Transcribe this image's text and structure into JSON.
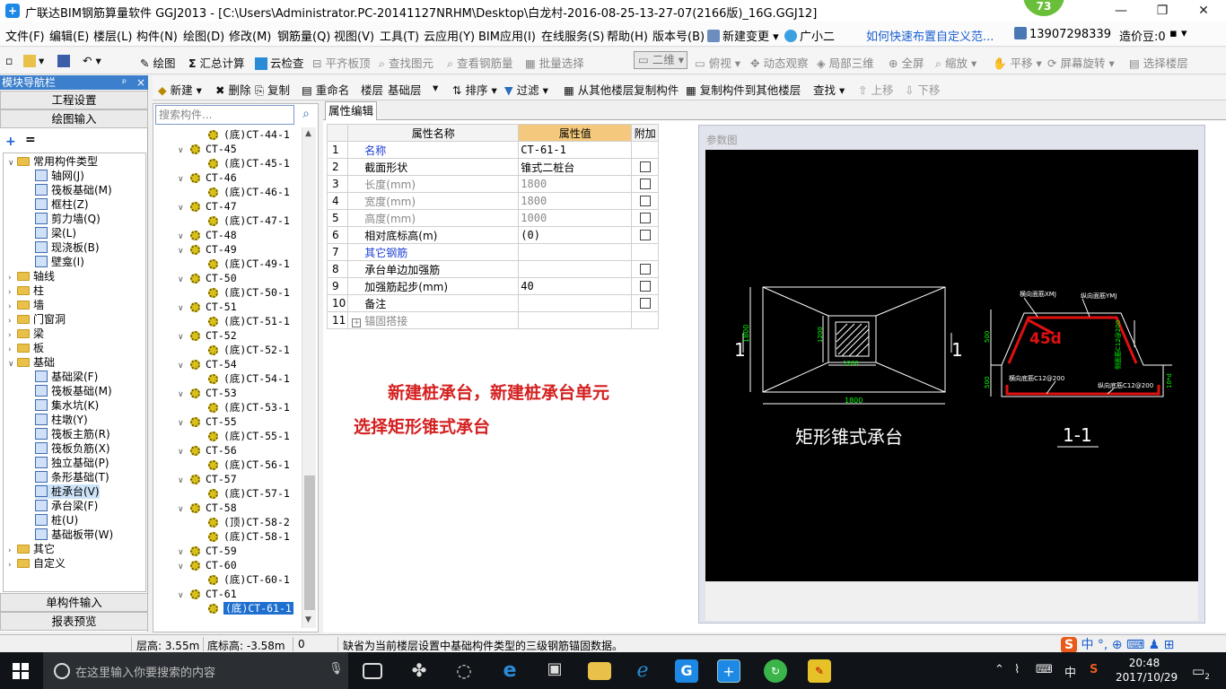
{
  "titlebar": {
    "title": "广联达BIM钢筋算量软件 GGJ2013 - [C:\\Users\\Administrator.PC-20141127NRHM\\Desktop\\白龙村-2016-08-25-13-27-07(2166版)_16G.GGJ12]",
    "badge": "73",
    "min": "—",
    "max": "❐",
    "close": "✕"
  },
  "menubar": {
    "items": [
      "文件(F)",
      "编辑(E)",
      "楼层(L)",
      "构件(N)",
      "绘图(D)",
      "修改(M)",
      "钢筋量(Q)",
      "视图(V)",
      "工具(T)",
      "云应用(Y)",
      "BIM应用(I)",
      "在线服务(S)",
      "帮助(H)",
      "版本号(B)"
    ],
    "new_change": "新建变更",
    "assistant": "广小二",
    "help_link": "如何快速布置自定义范...",
    "phone": "13907298339",
    "price_beans": "造价豆:0"
  },
  "toolbar1": {
    "draw": "绘图",
    "sum": "汇总计算",
    "cloud_check": "云检查",
    "flush_top": "平齐板顶",
    "find_element": "查找图元",
    "view_rebar": "查看钢筋量",
    "batch_select": "批量选择",
    "view_mode": "二维",
    "top_view": "俯视",
    "dynamic": "动态观察",
    "local_3d": "局部三维",
    "fullscreen": "全屏",
    "zoom": "缩放",
    "pan": "平移",
    "rotate": "屏幕旋转",
    "select_floor": "选择楼层"
  },
  "leftnav": {
    "header": "模块导航栏",
    "pin": "ᵖ",
    "close": "×",
    "project_settings": "工程设置",
    "drawing_input": "绘图输入",
    "single_input": "单构件输入",
    "report_preview": "报表预览",
    "tree": [
      {
        "label": "常用构件类型",
        "level": 0,
        "toggle": "∨",
        "kind": "folder"
      },
      {
        "label": "轴网(J)",
        "level": 1,
        "kind": "item"
      },
      {
        "label": "筏板基础(M)",
        "level": 1,
        "kind": "item"
      },
      {
        "label": "框柱(Z)",
        "level": 1,
        "kind": "item"
      },
      {
        "label": "剪力墙(Q)",
        "level": 1,
        "kind": "item"
      },
      {
        "label": "梁(L)",
        "level": 1,
        "kind": "item"
      },
      {
        "label": "现浇板(B)",
        "level": 1,
        "kind": "item"
      },
      {
        "label": "壁龛(I)",
        "level": 1,
        "kind": "item"
      },
      {
        "label": "轴线",
        "level": 0,
        "toggle": "›",
        "kind": "folder"
      },
      {
        "label": "柱",
        "level": 0,
        "toggle": "›",
        "kind": "folder"
      },
      {
        "label": "墙",
        "level": 0,
        "toggle": "›",
        "kind": "folder"
      },
      {
        "label": "门窗洞",
        "level": 0,
        "toggle": "›",
        "kind": "folder"
      },
      {
        "label": "梁",
        "level": 0,
        "toggle": "›",
        "kind": "folder"
      },
      {
        "label": "板",
        "level": 0,
        "toggle": "›",
        "kind": "folder"
      },
      {
        "label": "基础",
        "level": 0,
        "toggle": "∨",
        "kind": "folder"
      },
      {
        "label": "基础梁(F)",
        "level": 1,
        "kind": "item"
      },
      {
        "label": "筏板基础(M)",
        "level": 1,
        "kind": "item"
      },
      {
        "label": "集水坑(K)",
        "level": 1,
        "kind": "item"
      },
      {
        "label": "柱墩(Y)",
        "level": 1,
        "kind": "item"
      },
      {
        "label": "筏板主筋(R)",
        "level": 1,
        "kind": "item"
      },
      {
        "label": "筏板负筋(X)",
        "level": 1,
        "kind": "item"
      },
      {
        "label": "独立基础(P)",
        "level": 1,
        "kind": "item"
      },
      {
        "label": "条形基础(T)",
        "level": 1,
        "kind": "item"
      },
      {
        "label": "桩承台(V)",
        "level": 1,
        "kind": "item",
        "selected": true
      },
      {
        "label": "承台梁(F)",
        "level": 1,
        "kind": "item"
      },
      {
        "label": "桩(U)",
        "level": 1,
        "kind": "item"
      },
      {
        "label": "基础板带(W)",
        "level": 1,
        "kind": "item"
      },
      {
        "label": "其它",
        "level": 0,
        "toggle": "›",
        "kind": "folder"
      },
      {
        "label": "自定义",
        "level": 0,
        "toggle": "›",
        "kind": "folder"
      }
    ]
  },
  "comptoolbar": {
    "new": "新建",
    "delete": "删除",
    "copy": "复制",
    "rename": "重命名",
    "floor_label": "楼层",
    "floor_value": "基础层",
    "sort": "排序",
    "filter": "过滤",
    "copy_from": "从其他楼层复制构件",
    "copy_to": "复制构件到其他楼层",
    "find": "查找",
    "move_up": "上移",
    "move_down": "下移"
  },
  "search": {
    "placeholder": "搜索构件..."
  },
  "component_list": [
    {
      "label": "(底)CT-44-1",
      "level": 1
    },
    {
      "label": "CT-45",
      "level": 0
    },
    {
      "label": "(底)CT-45-1",
      "level": 1
    },
    {
      "label": "CT-46",
      "level": 0
    },
    {
      "label": "(底)CT-46-1",
      "level": 1
    },
    {
      "label": "CT-47",
      "level": 0
    },
    {
      "label": "(底)CT-47-1",
      "level": 1
    },
    {
      "label": "CT-48",
      "level": 0
    },
    {
      "label": "CT-49",
      "level": 0
    },
    {
      "label": "(底)CT-49-1",
      "level": 1
    },
    {
      "label": "CT-50",
      "level": 0
    },
    {
      "label": "(底)CT-50-1",
      "level": 1
    },
    {
      "label": "CT-51",
      "level": 0
    },
    {
      "label": "(底)CT-51-1",
      "level": 1
    },
    {
      "label": "CT-52",
      "level": 0
    },
    {
      "label": "(底)CT-52-1",
      "level": 1
    },
    {
      "label": "CT-54",
      "level": 0
    },
    {
      "label": "(底)CT-54-1",
      "level": 1
    },
    {
      "label": "CT-53",
      "level": 0
    },
    {
      "label": "(底)CT-53-1",
      "level": 1
    },
    {
      "label": "CT-55",
      "level": 0
    },
    {
      "label": "(底)CT-55-1",
      "level": 1
    },
    {
      "label": "CT-56",
      "level": 0
    },
    {
      "label": "(底)CT-56-1",
      "level": 1
    },
    {
      "label": "CT-57",
      "level": 0
    },
    {
      "label": "(底)CT-57-1",
      "level": 1
    },
    {
      "label": "CT-58",
      "level": 0
    },
    {
      "label": "(顶)CT-58-2",
      "level": 1
    },
    {
      "label": "(底)CT-58-1",
      "level": 1
    },
    {
      "label": "CT-59",
      "level": 0
    },
    {
      "label": "CT-60",
      "level": 0
    },
    {
      "label": "(底)CT-60-1",
      "level": 1
    },
    {
      "label": "CT-61",
      "level": 0
    },
    {
      "label": "(底)CT-61-1",
      "level": 1,
      "selected": true
    }
  ],
  "properties": {
    "tab": "属性编辑",
    "col_name": "属性名称",
    "col_value": "属性值",
    "col_extra": "附加",
    "rows": [
      {
        "n": "1",
        "name": "名称",
        "value": "CT-61-1",
        "style": "blue",
        "check": false
      },
      {
        "n": "2",
        "name": "截面形状",
        "value": "锥式二桩台",
        "style": "",
        "check": true
      },
      {
        "n": "3",
        "name": "长度(mm)",
        "value": "1800",
        "style": "gray",
        "check": true
      },
      {
        "n": "4",
        "name": "宽度(mm)",
        "value": "1800",
        "style": "gray",
        "check": true
      },
      {
        "n": "5",
        "name": "高度(mm)",
        "value": "1000",
        "style": "gray",
        "check": true
      },
      {
        "n": "6",
        "name": "相对底标高(m)",
        "value": "(0)",
        "style": "",
        "check": true
      },
      {
        "n": "7",
        "name": "其它钢筋",
        "value": "",
        "style": "blue",
        "check": false
      },
      {
        "n": "8",
        "name": "承台单边加强筋",
        "value": "",
        "style": "",
        "check": true
      },
      {
        "n": "9",
        "name": "加强筋起步(mm)",
        "value": "40",
        "style": "",
        "check": true
      },
      {
        "n": "10",
        "name": "备注",
        "value": "",
        "style": "",
        "check": true
      },
      {
        "n": "11",
        "name": "锚固搭接",
        "value": "",
        "style": "gray",
        "check": false,
        "expand": true
      }
    ]
  },
  "annotation": {
    "line1": "新建桩承台，新建桩承台单元",
    "line2": "选择矩形锥式承台"
  },
  "param_image": {
    "label": "参数图",
    "plan_title": "矩形锥式承台",
    "section_title": "1-1",
    "dim_1800_h": "1800",
    "dim_1800_v": "1800",
    "dim_1200_h": "1200",
    "dim_1200_v": "1200",
    "section_mark": "1",
    "rebar_top_x": "横向面筋XMJ",
    "rebar_top_y": "纵向面筋YMJ",
    "rebar_side": "侧面筋C12@200",
    "rebar_bot_x": "横向底筋C12@200",
    "rebar_bot_y": "纵向底筋C12@200",
    "angle": "45d",
    "dim_500_a": "500",
    "dim_500_b": "500",
    "dim_10d": "10*d"
  },
  "statusbar": {
    "floor_height": "层高: 3.55m",
    "bottom_elev": "底标高: -3.58m",
    "zero": "0",
    "message": "缺省为当前楼层设置中基础构件类型的三级钢筋锚固数据。"
  },
  "taskbar": {
    "search_placeholder": "在这里输入你要搜索的内容",
    "ime": "中",
    "time": "20:48",
    "date": "2017/10/29",
    "notif": "2"
  },
  "colors": {
    "accent": "#3c7fcd",
    "annotation": "#d42020",
    "header_value": "#f5c97d",
    "badge": "#6abf3a"
  }
}
